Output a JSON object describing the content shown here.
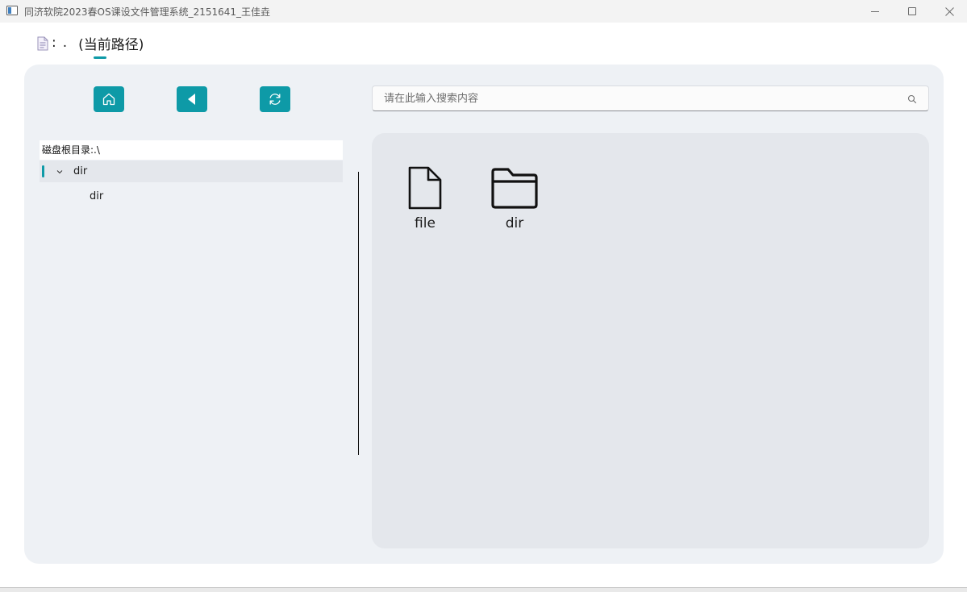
{
  "window": {
    "title": "同济软院2023春OS课设文件管理系统_2151641_王佳垚",
    "controls": {
      "minimize_icon": "minimize-icon",
      "maximize_icon": "maximize-icon",
      "close_icon": "close-icon"
    }
  },
  "path_header": {
    "icon": "document-icon",
    "colon": ":",
    "current_path": ".",
    "caption": "(当前路径)"
  },
  "toolbar": {
    "home_icon": "home-icon",
    "back_icon": "back-arrow-icon",
    "refresh_icon": "refresh-icon",
    "accent_color": "#0e9aa7"
  },
  "search": {
    "placeholder": "请在此输入搜索内容",
    "value": "",
    "icon": "search-icon"
  },
  "tree": {
    "header": "磁盘根目录:.\\",
    "items": [
      {
        "label": "dir",
        "expanded": true,
        "selected": true
      },
      {
        "label": "dir",
        "expanded": false,
        "selected": false
      }
    ]
  },
  "files": {
    "items": [
      {
        "label": "file",
        "icon": "file-icon"
      },
      {
        "label": "dir",
        "icon": "folder-icon"
      }
    ]
  },
  "colors": {
    "panel_bg": "#eef1f5",
    "file_area_bg": "#e4e7ec",
    "accent": "#0e9aa7"
  }
}
